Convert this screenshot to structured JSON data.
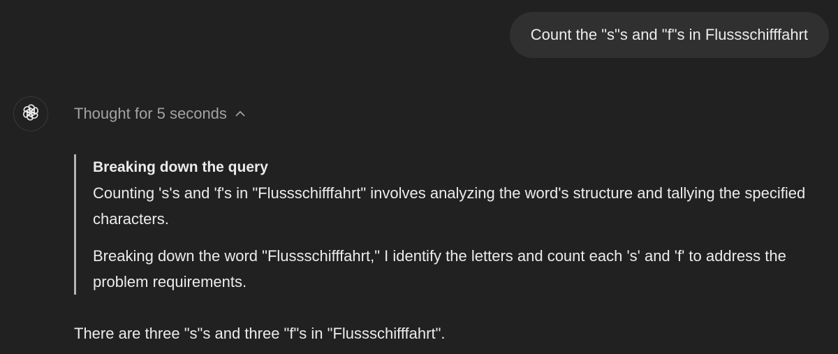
{
  "user_message": {
    "text": "Count the \"s\"s and \"f\"s in Flussschifffahrt"
  },
  "assistant": {
    "avatar_icon": "openai-logo-icon",
    "thought_toggle": {
      "label": "Thought for 5 seconds",
      "icon": "chevron-up-icon"
    },
    "thought": {
      "heading": "Breaking down the query",
      "paragraphs": [
        "Counting 's's and 'f's in \"Flussschifffahrt\" involves analyzing the word's structure and tallying the specified characters.",
        "Breaking down the word \"Flussschifffahrt,\" I identify the letters and count each 's' and 'f' to address the problem requirements."
      ]
    },
    "answer": "There are three \"s\"s and three \"f\"s in \"Flussschifffahrt\"."
  },
  "colors": {
    "background": "#212121",
    "user_bubble": "#303030",
    "text_primary": "#ececec",
    "text_muted": "#a3a3a3",
    "quote_border": "#b4b4b4"
  }
}
